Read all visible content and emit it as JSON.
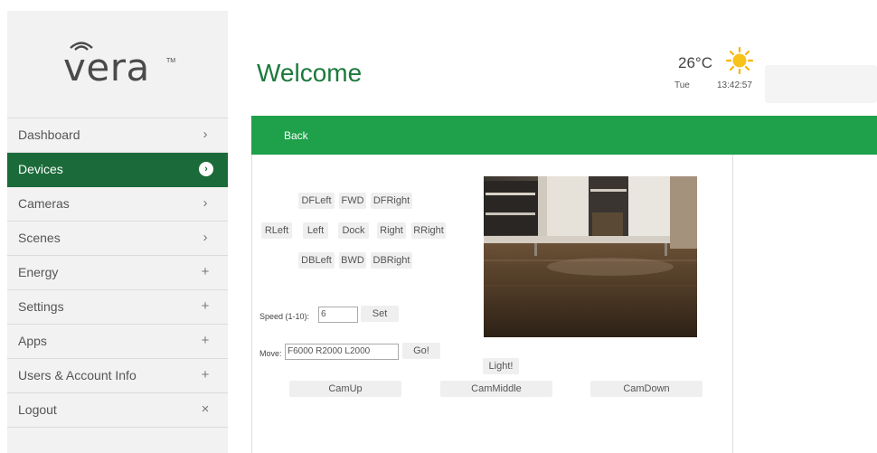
{
  "brand": {
    "logo_text": "vera",
    "logo_tm": "TM"
  },
  "sidebar": {
    "items": [
      {
        "label": "Dashboard",
        "indicator": "›"
      },
      {
        "label": "Devices",
        "indicator": "›"
      },
      {
        "label": "Cameras",
        "indicator": "›"
      },
      {
        "label": "Scenes",
        "indicator": "›"
      },
      {
        "label": "Energy",
        "indicator": "+"
      },
      {
        "label": "Settings",
        "indicator": "+"
      },
      {
        "label": "Apps",
        "indicator": "+"
      },
      {
        "label": "Users & Account Info",
        "indicator": "+"
      },
      {
        "label": "Logout",
        "indicator": "×"
      }
    ],
    "active_index": 1
  },
  "header": {
    "title": "Welcome",
    "temperature": "26°C",
    "weather_icon": "sun-icon",
    "day": "Tue",
    "time": "13:42:57"
  },
  "toolbar": {
    "back_label": "Back"
  },
  "controls": {
    "row1": [
      "DFLeft",
      "FWD",
      "DFRight"
    ],
    "row2": [
      "RLeft",
      "Left",
      "Dock",
      "Right",
      "RRight"
    ],
    "row3": [
      "DBLeft",
      "BWD",
      "DBRight"
    ],
    "speed_label": "Speed (1-10):",
    "speed_value": "6",
    "set_label": "Set",
    "move_label": "Move:",
    "move_value": "F6000 R2000 L2000",
    "go_label": "Go!",
    "light_label": "Light!",
    "cam_buttons": [
      "CamUp",
      "CamMiddle",
      "CamDown"
    ]
  },
  "colors": {
    "accent": "#1fa04a",
    "active_nav": "#1b6b3a",
    "title": "#1b7a3c",
    "sun": "#f7b500"
  }
}
